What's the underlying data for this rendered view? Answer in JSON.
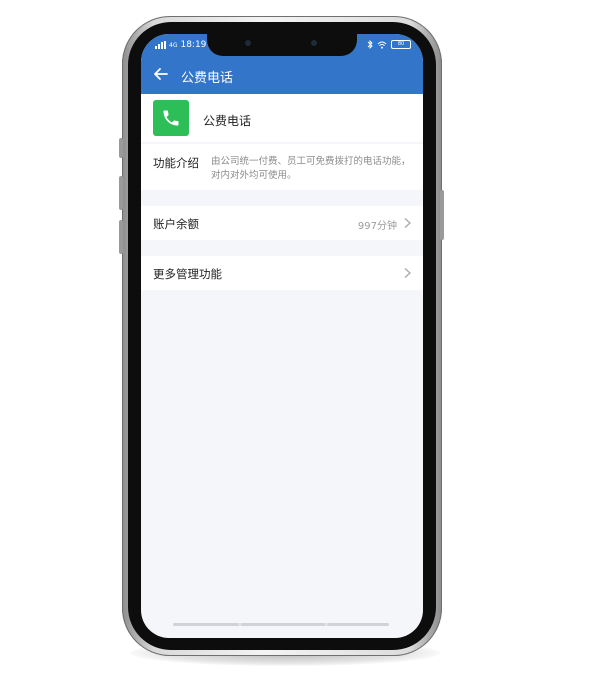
{
  "status_bar": {
    "time": "18:19",
    "signal_text": "4G",
    "battery": "80",
    "icons": [
      "signal-icon",
      "bluetooth-icon",
      "wifi-icon",
      "battery-icon"
    ]
  },
  "header": {
    "title": "公费电话",
    "back_icon": "arrow-left-icon",
    "background": "#3275c9"
  },
  "app": {
    "name": "公费电话",
    "icon": "phone-handset-icon",
    "icon_color": "#2dbe57"
  },
  "intro": {
    "label": "功能介绍",
    "description": "由公司统一付费、员工可免费拨打的电话功能，对内对外均可使用。"
  },
  "rows": [
    {
      "label": "账户余额",
      "value": "997分钟"
    },
    {
      "label": "更多管理功能",
      "value": ""
    }
  ]
}
